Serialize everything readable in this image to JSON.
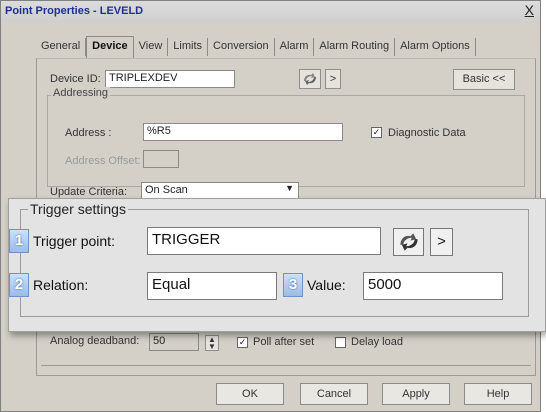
{
  "window": {
    "title": "Point Properties - LEVELD",
    "close_glyph": "X"
  },
  "tabs": [
    "General",
    "Device",
    "View",
    "Limits",
    "Conversion",
    "Alarm",
    "Alarm Routing",
    "Alarm Options"
  ],
  "active_tab": "Device",
  "device": {
    "device_id_label": "Device ID:",
    "device_id_value": "TRIPLEXDEV",
    "browse_glyph": ">",
    "basic_button": "Basic <<"
  },
  "addressing": {
    "title": "Addressing",
    "address_label": "Address :",
    "address_value": "%R5",
    "diagnostic_label": "Diagnostic Data",
    "diagnostic_checked": true,
    "offset_label": "Address Offset:",
    "offset_value": ""
  },
  "update": {
    "label": "Update Criteria:",
    "value": "On Scan"
  },
  "behind": {
    "deadband_label": "Analog deadband:",
    "deadband_value": "50",
    "poll_label": "Poll after set",
    "poll_checked": true,
    "delay_label": "Delay load",
    "delay_checked": false
  },
  "trigger": {
    "title": "Trigger settings",
    "badge1": "1",
    "point_label": "Trigger point:",
    "point_value": "TRIGGER",
    "browse_glyph": ">",
    "badge2": "2",
    "relation_label": "Relation:",
    "relation_value": "Equal",
    "badge3": "3",
    "value_label": "Value:",
    "value_value": "5000"
  },
  "buttons": {
    "ok": "OK",
    "cancel": "Cancel",
    "apply": "Apply",
    "help": "Help"
  },
  "icons": {
    "close": "close-icon",
    "tag_browser": "tag-browser-icon",
    "dropdown": "chevron-down-icon",
    "spinner": "spinner-icon",
    "check": "checkmark-icon"
  }
}
